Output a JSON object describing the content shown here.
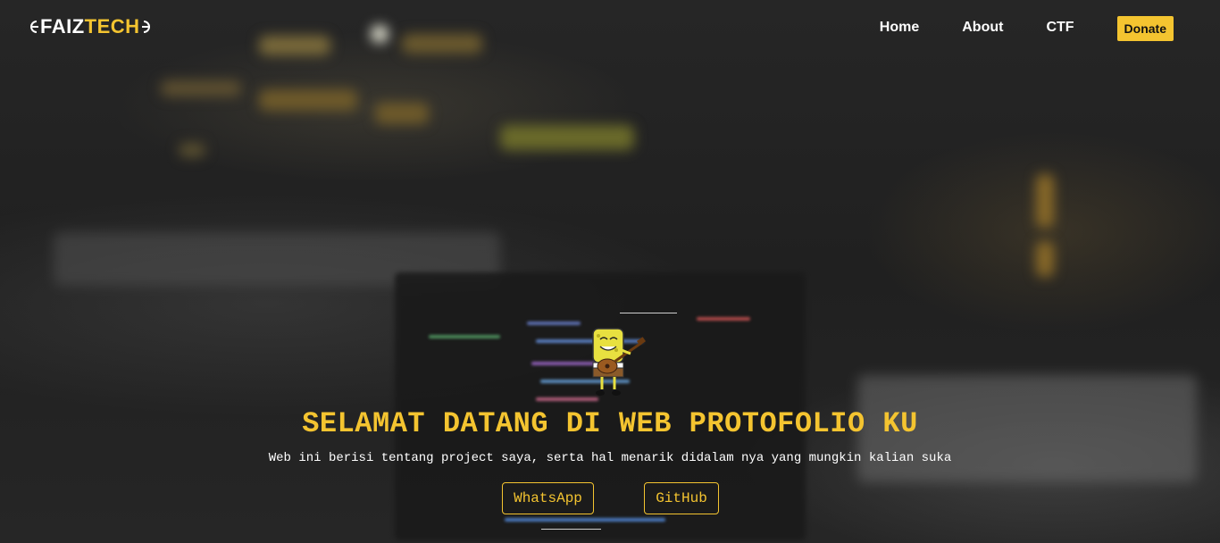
{
  "brand": {
    "name_part_1": "FAIZ",
    "name_part_2": "TECH"
  },
  "nav": {
    "items": [
      {
        "label": "Home"
      },
      {
        "label": "About"
      },
      {
        "label": "CTF"
      }
    ],
    "donate_label": "Donate"
  },
  "hero": {
    "title": "SELAMAT DATANG DI WEB PROTOFOLIO KU",
    "subtitle": "Web ini berisi tentang project saya, serta hal menarik didalam nya yang mungkin kalian suka",
    "buttons": {
      "whatsapp_label": "WhatsApp",
      "github_label": "GitHub"
    },
    "mascot_icon": "spongebob-ukulele-icon"
  },
  "colors": {
    "accent": "#f4c430",
    "text": "#ffffff",
    "background": "#232323"
  }
}
